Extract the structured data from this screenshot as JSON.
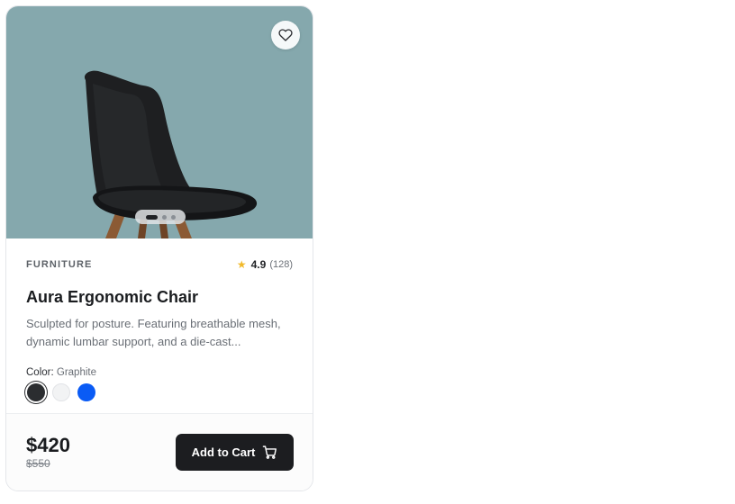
{
  "product": {
    "category": "FURNITURE",
    "rating": "4.9",
    "review_count": "(128)",
    "title": "Aura Ergonomic Chair",
    "description": "Sculpted for posture. Featuring breathable mesh, dynamic lumbar support, and a die-cast...",
    "color_label": "Color:",
    "color_value": "Graphite",
    "swatches": [
      {
        "name": "graphite",
        "hex": "#2b2d30",
        "selected": true
      },
      {
        "name": "white",
        "hex": "#f2f3f4",
        "selected": false
      },
      {
        "name": "blue",
        "hex": "#0a5bf5",
        "selected": false
      }
    ]
  },
  "gallery": {
    "image_count": 3,
    "active_index": 0,
    "background_color": "#85a8ad"
  },
  "pricing": {
    "price": "$420",
    "original_price": "$550"
  },
  "actions": {
    "add_to_cart_label": "Add to Cart",
    "favorite_icon": "heart-icon",
    "cart_icon": "cart-icon"
  },
  "colors": {
    "rating_star": "#f1b92a",
    "button_bg": "#1c1d20"
  }
}
